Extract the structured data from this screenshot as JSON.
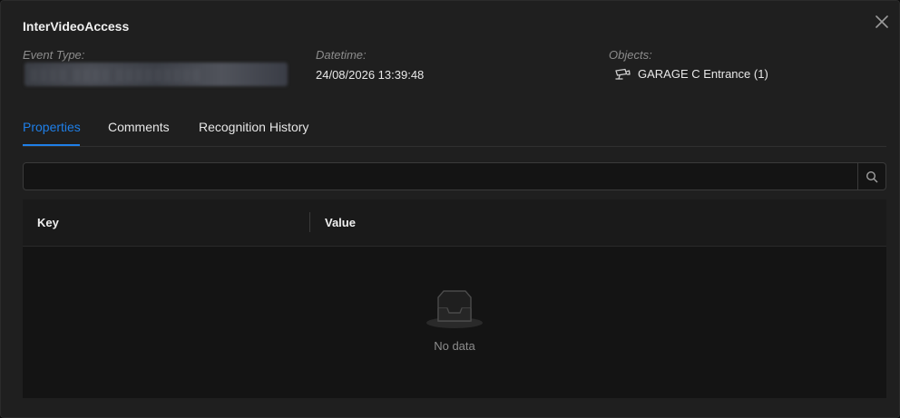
{
  "modal": {
    "title": "InterVideoAccess",
    "close_icon": "close-icon"
  },
  "meta": {
    "event_type": {
      "label": "Event Type:",
      "value": "░░░░ ░░░░ ░░░░░░░░░"
    },
    "datetime": {
      "label": "Datetime:",
      "value": "24/08/2026 13:39:48"
    },
    "objects": {
      "label": "Objects:",
      "icon": "camera-icon",
      "value": "GARAGE C Entrance (1)"
    }
  },
  "tabs": [
    {
      "label": "Properties",
      "active": true
    },
    {
      "label": "Comments",
      "active": false
    },
    {
      "label": "Recognition History",
      "active": false
    }
  ],
  "search": {
    "value": "",
    "placeholder": "",
    "icon": "search-icon"
  },
  "table": {
    "columns": [
      "Key",
      "Value"
    ],
    "rows": [],
    "empty_text": "No data",
    "empty_icon": "inbox-icon"
  },
  "colors": {
    "accent": "#1f7fe8",
    "background": "#1f1f1f",
    "muted_text": "#8c8c8c"
  }
}
